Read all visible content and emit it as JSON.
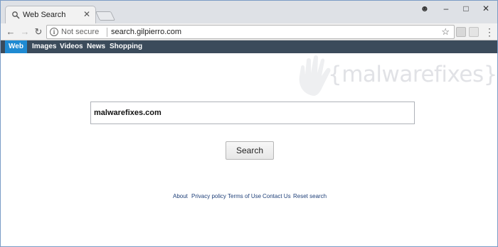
{
  "tab": {
    "title": "Web Search",
    "close": "✕"
  },
  "window_controls": {
    "profile": "☻",
    "minimize": "–",
    "maximize": "□",
    "close": "✕"
  },
  "toolbar": {
    "back": "←",
    "forward": "→",
    "reload": "↻",
    "security_label": "Not secure",
    "url": "search.gilpierro.com",
    "star": "☆",
    "menu": "⋮"
  },
  "search_nav": {
    "items": [
      {
        "label": "Web",
        "active": true
      },
      {
        "label": "Images",
        "active": false
      },
      {
        "label": "Videos",
        "active": false
      },
      {
        "label": "News",
        "active": false
      },
      {
        "label": "Shopping",
        "active": false
      }
    ]
  },
  "watermark": {
    "text": "{malwarefixes}"
  },
  "search": {
    "query": "malwarefixes.com",
    "button_label": "Search"
  },
  "footer": {
    "links": [
      "About",
      "Privacy policy",
      "Terms of Use",
      "Contact Us",
      "Reset search"
    ]
  },
  "colors": {
    "nav_bg": "#3b4b5b",
    "nav_active": "#1f8ad2",
    "link": "#1e3f78"
  }
}
